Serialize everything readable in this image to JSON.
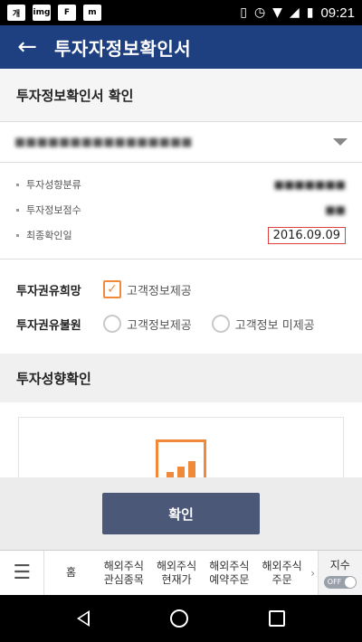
{
  "status_bar": {
    "left_icons": [
      "개",
      "img",
      "F",
      "m"
    ],
    "time": "09:21"
  },
  "header": {
    "title": "투자자정보확인서"
  },
  "section": {
    "title": "투자정보확인서 확인"
  },
  "account_select": {
    "value": "■■■■■■■■■■■■■■■■"
  },
  "info": {
    "rows": [
      {
        "label": "투자성향분류",
        "value": "■■■■■■■"
      },
      {
        "label": "투자정보점수",
        "value": "■■"
      },
      {
        "label": "최종확인일",
        "value": "2016.09.09"
      }
    ]
  },
  "consent": {
    "wish_label": "투자권유희망",
    "wish_option": "고객정보제공",
    "unwanted_label": "투자권유불원",
    "unwanted_option1": "고객정보제공",
    "unwanted_option2": "고객정보 미제공"
  },
  "propensity": {
    "title": "투자성향확인"
  },
  "confirm": {
    "label": "확인"
  },
  "bottom_nav": {
    "items": [
      "홈",
      "해외주식\n관심종목",
      "해외주식\n현재가",
      "해외주식\n예약주문",
      "해외주식\n주문"
    ],
    "index_label": "지수",
    "toggle_label": "OFF"
  },
  "colors": {
    "header_bg": "#1e3f80",
    "accent": "#f08a3a",
    "button_bg": "#4b5877",
    "date_border": "#e04040"
  }
}
